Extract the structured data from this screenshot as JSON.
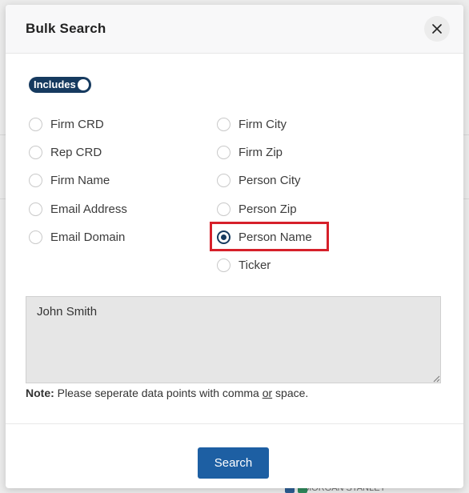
{
  "modal": {
    "title": "Bulk Search",
    "close_label": "X"
  },
  "toggle": {
    "label": "Includes",
    "state": "on"
  },
  "options_left": [
    {
      "label": "Firm CRD",
      "checked": false
    },
    {
      "label": "Rep CRD",
      "checked": false
    },
    {
      "label": "Firm Name",
      "checked": false
    },
    {
      "label": "Email Address",
      "checked": false
    },
    {
      "label": "Email Domain",
      "checked": false
    }
  ],
  "options_right": [
    {
      "label": "Firm City",
      "checked": false
    },
    {
      "label": "Firm Zip",
      "checked": false
    },
    {
      "label": "Person City",
      "checked": false
    },
    {
      "label": "Person Zip",
      "checked": false
    },
    {
      "label": "Person Name",
      "checked": true
    },
    {
      "label": "Ticker",
      "checked": false
    }
  ],
  "textarea": {
    "value": "John Smith"
  },
  "note": {
    "prefix": "Note:",
    "text_before": " Please seperate data points with comma ",
    "or": "or",
    "text_after": " space."
  },
  "footer": {
    "search_label": "Search"
  },
  "background": {
    "footer_text": "MORGAN STANLEY"
  },
  "colors": {
    "accent_navy": "#163a5f",
    "button_blue": "#1d5fa3",
    "highlight_red": "#d6202a"
  }
}
